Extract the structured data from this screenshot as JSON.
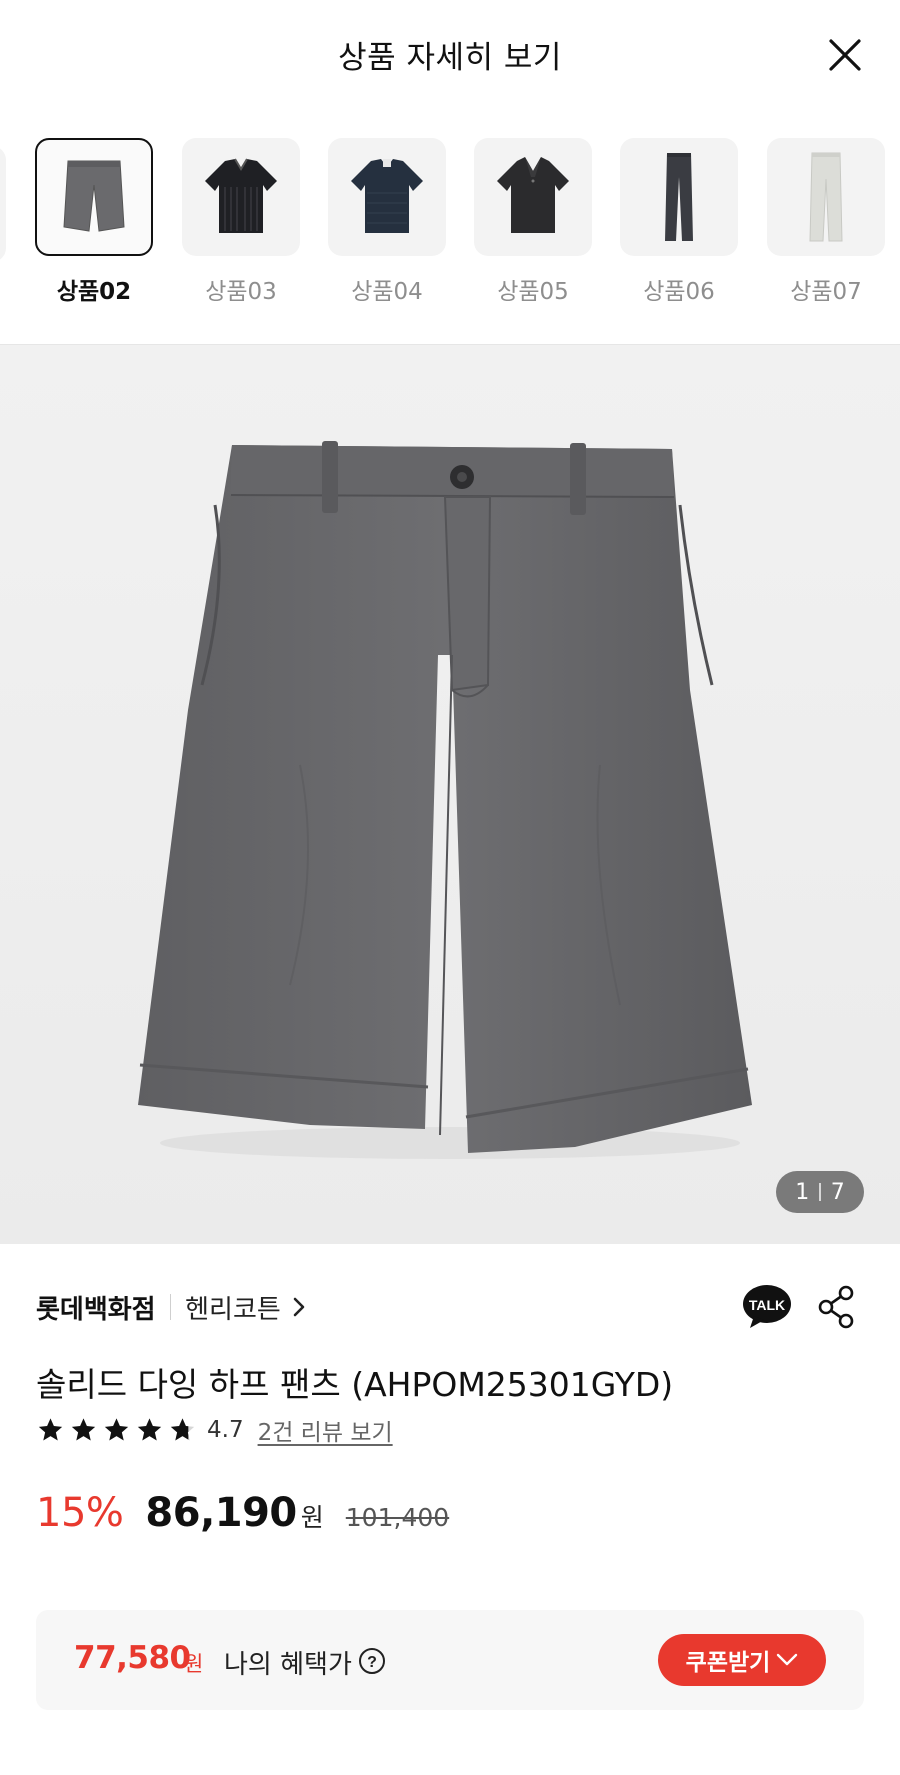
{
  "header": {
    "title": "상품 자세히 보기",
    "close_icon": "close-icon"
  },
  "thumbnails": [
    {
      "label": "상품02",
      "active": true,
      "kind": "shorts-gray"
    },
    {
      "label": "상품03",
      "active": false,
      "kind": "knit-polo-black"
    },
    {
      "label": "상품04",
      "active": false,
      "kind": "knit-navy"
    },
    {
      "label": "상품05",
      "active": false,
      "kind": "polo-dark"
    },
    {
      "label": "상품06",
      "active": false,
      "kind": "pants-charcoal"
    },
    {
      "label": "상품07",
      "active": false,
      "kind": "pants-white"
    }
  ],
  "gallery": {
    "current": "1",
    "total": "7"
  },
  "product": {
    "store": "롯데백화점",
    "brand": "헨리코튼",
    "name": "솔리드 다잉 하프 팬츠 (AHPOM25301GYD)",
    "rating": "4.7",
    "stars": 4.7,
    "review_link": "2건 리뷰 보기"
  },
  "price": {
    "discount": "15%",
    "sale": "86,190",
    "won": "원",
    "original": "101,400"
  },
  "benefit": {
    "price": "77,580",
    "won": "원",
    "label": "나의 혜택가",
    "coupon_button": "쿠폰받기"
  },
  "icons": {
    "talk": "kakao-talk-icon",
    "share": "share-icon",
    "chevron": "chevron-right-icon",
    "help": "question-circle-icon",
    "coupon_chevron": "chevron-down-icon"
  },
  "colors": {
    "accent": "#e8392e",
    "text": "#111111",
    "muted": "#8e8e8e"
  }
}
